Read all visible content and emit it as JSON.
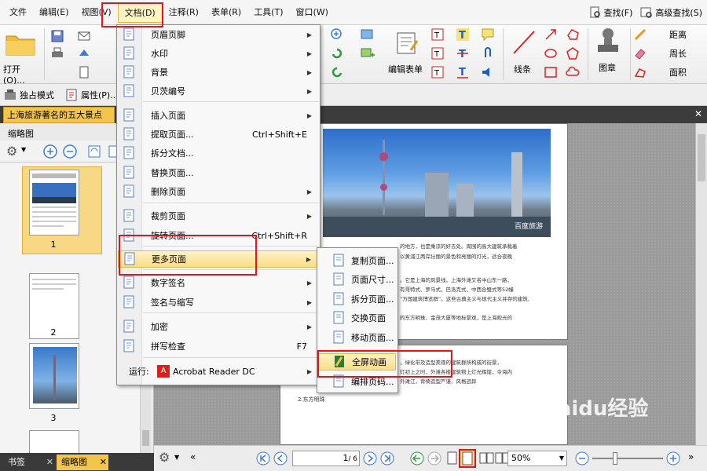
{
  "menubar": {
    "items": [
      "文件",
      "编辑(E)",
      "视图(V)",
      "文档(D)",
      "注释(R)",
      "表单(R)",
      "工具(T)",
      "窗口(W)"
    ],
    "active_index": 3,
    "search": "查找(F)",
    "advanced_search": "高级查找(S)"
  },
  "ribbon": {
    "open": "打开(O)...",
    "edit_form": "编辑表单",
    "lines": "线条",
    "stamp": "图章",
    "distance": "距离",
    "perimeter": "周长",
    "area": "面积"
  },
  "row2": {
    "exclusive": "独占模式",
    "properties": "属性(P)..."
  },
  "doc_tab": "上海旅游著名的五大景点",
  "left_panel": {
    "title": "缩略图",
    "thumb_labels": [
      "1",
      "2",
      "3"
    ]
  },
  "bottom_tabs": [
    "书签",
    "缩略图"
  ],
  "status": {
    "page_input": "1",
    "page_total": "/ 6",
    "zoom": "50%"
  },
  "document_menu": {
    "items": [
      {
        "label": "页眉页脚",
        "shortcut": "",
        "arrow": true,
        "icon": "header-footer-icon"
      },
      {
        "label": "水印",
        "shortcut": "",
        "arrow": true,
        "icon": "watermark-icon"
      },
      {
        "label": "背景",
        "shortcut": "",
        "arrow": true,
        "icon": "background-icon"
      },
      {
        "label": "贝茨编号",
        "shortcut": "",
        "arrow": true,
        "icon": "bates-number-icon"
      },
      {
        "label": "插入页面",
        "shortcut": "",
        "arrow": true,
        "icon": "insert-page-icon"
      },
      {
        "label": "提取页面...",
        "shortcut": "Ctrl+Shift+E",
        "arrow": false,
        "icon": "extract-page-icon"
      },
      {
        "label": "拆分文档...",
        "shortcut": "",
        "arrow": false,
        "icon": "split-document-icon"
      },
      {
        "label": "替换页面...",
        "shortcut": "",
        "arrow": false,
        "icon": "replace-page-icon"
      },
      {
        "label": "删除页面",
        "shortcut": "",
        "arrow": true,
        "icon": "delete-page-icon"
      },
      {
        "label": "裁剪页面",
        "shortcut": "",
        "arrow": true,
        "icon": "crop-page-icon"
      },
      {
        "label": "旋转页面...",
        "shortcut": "Ctrl+Shift+R",
        "arrow": false,
        "icon": "rotate-page-icon"
      },
      {
        "label": "更多页面",
        "shortcut": "",
        "arrow": true,
        "icon": "more-pages-icon"
      },
      {
        "label": "数字签名",
        "shortcut": "",
        "arrow": true,
        "icon": "digital-signature-icon"
      },
      {
        "label": "签名与缩写",
        "shortcut": "",
        "arrow": true,
        "icon": "sign-initials-icon"
      },
      {
        "label": "加密",
        "shortcut": "",
        "arrow": true,
        "icon": "encrypt-icon"
      },
      {
        "label": "拼写检查",
        "shortcut": "F7",
        "arrow": false,
        "icon": "spell-check-icon"
      }
    ],
    "run_label": "运行:",
    "run_app": "Acrobat Reader DC"
  },
  "more_pages_submenu": {
    "items": [
      {
        "label": "复制页面...",
        "icon": "copy-page-icon"
      },
      {
        "label": "页面尺寸...",
        "icon": "page-size-icon"
      },
      {
        "label": "拆分页面...",
        "icon": "split-page-icon"
      },
      {
        "label": "交换页面",
        "icon": "swap-page-icon"
      },
      {
        "label": "移动页面...",
        "icon": "move-page-icon"
      },
      {
        "label": "全屏动画",
        "icon": "fullscreen-animation-icon"
      },
      {
        "label": "编排页码...",
        "icon": "page-numbering-icon"
      }
    ]
  },
  "page_text": {
    "para1": "的地方，也是乘凉的好去处。周围的高大建筑承载着",
    "para1b": "以黄浦江两岸壮丽的景色和亮丽的灯光，适合夜晚",
    "para2": "。它是上海的风景线。上海外滩又名中山东一路，",
    "para2b": "有哥特式、罗马式、巴洛克式、中西合璧式等52幢",
    "para2c": "“万国建筑博览群”。这些古典主义与现代主义并存的建筑,",
    "para3": "的东方明珠、金茂大厦等地标景观，是上海观光的",
    "para4": "，绿化带及造型美观的建筑群所构成的街景，",
    "para4b": "灯初上之时，外滩各楼建筑物上灯光辉煌，令海内",
    "para4c": "外滩江，背倚造型严谨、风格迥异",
    "heading2": "2.东方明珠",
    "photo_watermark": "百度旅游"
  },
  "watermark": "Baidu经验"
}
